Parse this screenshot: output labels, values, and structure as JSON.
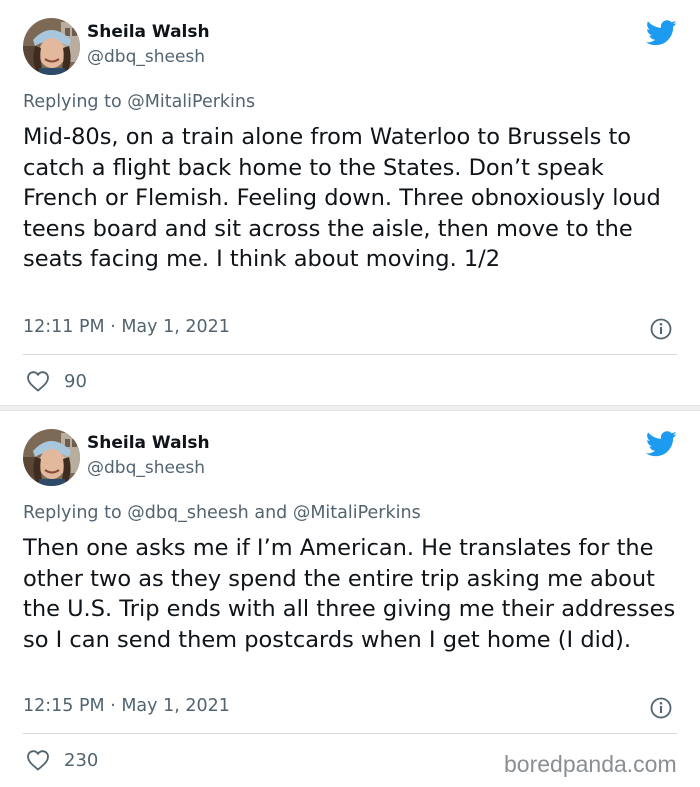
{
  "colors": {
    "twitter_blue": "#1d9bf0",
    "text_primary": "#0f1419",
    "text_secondary": "#536471",
    "divider": "#d4dbe0"
  },
  "tweets": [
    {
      "author_name": "Sheila Walsh",
      "author_handle": "@dbq_sheesh",
      "reply_prefix": "Replying to",
      "reply_mentions": "@MitaliPerkins",
      "text": "Mid-80s, on a train alone from Waterloo to Brussels to catch a flight back home to the States. Don’t speak French or Flemish. Feeling down. Three obnoxiously loud teens board and sit across the aisle, then move to the seats facing me. I think about moving. 1/2",
      "timestamp": "12:11 PM · May 1, 2021",
      "likes": "90",
      "icons": [
        "twitter-bird-icon",
        "info-icon",
        "heart-icon"
      ]
    },
    {
      "author_name": "Sheila Walsh",
      "author_handle": "@dbq_sheesh",
      "reply_prefix": "Replying to",
      "reply_mentions": "@dbq_sheesh and @MitaliPerkins",
      "text": "Then one asks me if I’m American. He translates for the other two as they spend the entire trip asking me about the U.S. Trip ends with all three giving me their addresses so I can send them postcards when I get home (I did).",
      "timestamp": "12:15 PM · May 1, 2021",
      "likes": "230",
      "icons": [
        "twitter-bird-icon",
        "info-icon",
        "heart-icon"
      ]
    }
  ],
  "watermark": "boredpanda.com"
}
